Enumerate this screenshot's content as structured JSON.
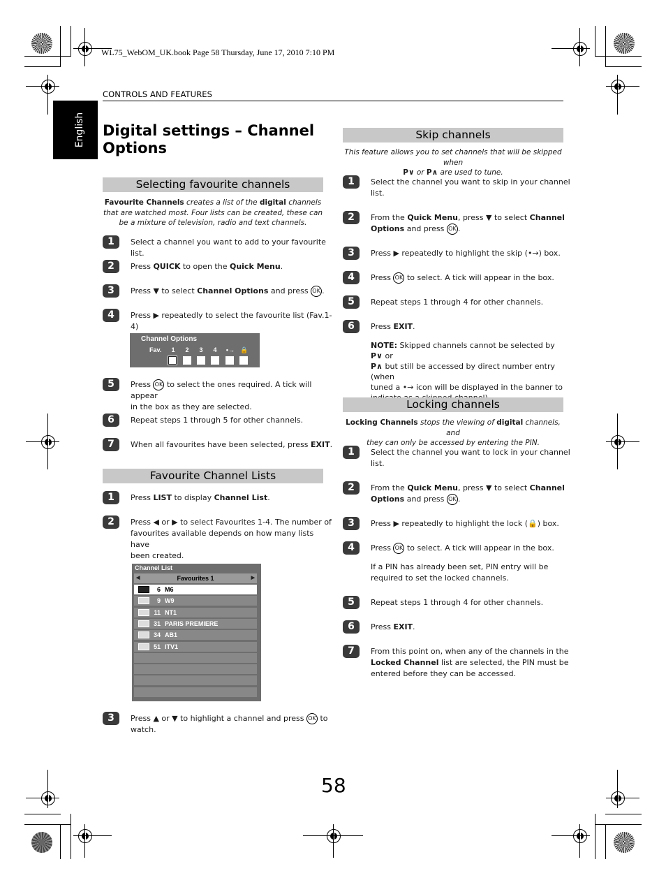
{
  "book_header": "WL75_WebOM_UK.book  Page 58  Thursday, June 17, 2010  7:10 PM",
  "section_label": "CONTROLS AND FEATURES",
  "language_tab": "English",
  "page_title": "Digital settings – Channel Options",
  "page_number": "58",
  "selecting_favourites": {
    "heading": "Selecting favourite channels",
    "intro_bold1": "Favourite Channels",
    "intro_part1": " creates a list of the ",
    "intro_bold2": "digital",
    "intro_part2": " channels that are watched most. Four lists can be created, these can be a mixture of television, radio and text channels.",
    "steps": [
      {
        "num": "1",
        "html": "Select a channel you want to add to your favourite list."
      },
      {
        "num": "2",
        "html": "Press <b>QUICK</b> to open the <b>Quick Menu</b>."
      },
      {
        "num": "3",
        "html": "Press ▼ to select <b>Channel Options</b> and press <span class='ok'>OK</span>."
      },
      {
        "num": "4",
        "html": "Press ▶ repeatedly to select the favourite list (Fav.1-4)"
      },
      {
        "num": "5",
        "html": "Press <span class='ok'>OK</span> to select the ones required. A tick will appear<br>in the box as they are selected."
      },
      {
        "num": "6",
        "html": "Repeat steps 1 through 5 for other channels."
      },
      {
        "num": "7",
        "html": "When all favourites have been selected, press <b>EXIT</b>."
      }
    ]
  },
  "channel_options_panel": {
    "title": "Channel Options",
    "row_label": "Fav.",
    "columns": [
      "1",
      "2",
      "3",
      "4",
      "skip-icon",
      "lock-icon"
    ],
    "selected_column": "1"
  },
  "favourite_lists": {
    "heading": "Favourite Channel Lists",
    "steps": [
      {
        "num": "1",
        "html": "Press <b>LIST</b> to display <b>Channel List</b>."
      },
      {
        "num": "2",
        "html": "Press ◀ or ▶ to select Favourites 1-4. The number of<br>favourites available depends on how many lists have<br>been created."
      },
      {
        "num": "3",
        "html": "Press ▲ or ▼ to highlight a channel and press <span class='ok'>OK</span> to<br>watch."
      }
    ]
  },
  "channel_list_panel": {
    "title": "Channel List",
    "tab_label": "Favourites 1",
    "rows": [
      {
        "num": "6",
        "name": "M6",
        "selected": true
      },
      {
        "num": "9",
        "name": "W9",
        "selected": false
      },
      {
        "num": "11",
        "name": "NT1",
        "selected": false
      },
      {
        "num": "31",
        "name": "PARIS PREMIERE",
        "selected": false
      },
      {
        "num": "34",
        "name": "AB1",
        "selected": false
      },
      {
        "num": "51",
        "name": "ITV1",
        "selected": false
      }
    ],
    "empty_rows": 4
  },
  "skip_channels": {
    "heading": "Skip channels",
    "intro_html": "This feature allows you to set channels that will be skipped when<br><b>P∨</b> or <b>P∧</b> are used to tune.",
    "steps": [
      {
        "num": "1",
        "html": "Select the channel you want to skip in your channel<br>list."
      },
      {
        "num": "2",
        "html": "From the <b>Quick Menu</b>, press ▼ to select <b>Channel<br>Options</b> and press <span class='ok'>OK</span>."
      },
      {
        "num": "3",
        "html": "Press ▶ repeatedly to highlight the skip (•→) box."
      },
      {
        "num": "4",
        "html": "Press <span class='ok'>OK</span> to select. A tick will appear in the box."
      },
      {
        "num": "5",
        "html": "Repeat steps 1 through 4 for other channels."
      },
      {
        "num": "6",
        "html": "Press <b>EXIT</b>."
      }
    ],
    "note_html": "<b>NOTE:</b> Skipped channels cannot be selected by <b>P∨</b> or<br><b>P∧</b> but still be accessed by direct number entry (when<br>tuned a •→ icon will be displayed in the banner to<br>indicate as a skipped channel)."
  },
  "locking_channels": {
    "heading": "Locking channels",
    "intro_html": "<b>Locking Channels</b> stops the viewing of <b>digital</b> channels, and<br>they can only be accessed by entering the PIN.",
    "steps": [
      {
        "num": "1",
        "html": "Select the channel you want to lock in your channel<br>list."
      },
      {
        "num": "2",
        "html": "From the <b>Quick Menu</b>, press ▼ to select <b>Channel<br>Options</b> and press <span class='ok'>OK</span>."
      },
      {
        "num": "3",
        "html": "Press ▶ repeatedly to highlight the lock (🔒) box."
      },
      {
        "num": "4",
        "html": "Press <span class='ok'>OK</span> to select. A tick will appear in the box."
      },
      {
        "num": "5",
        "html": "Repeat steps 1 through 4 for other channels."
      },
      {
        "num": "6",
        "html": "Press <b>EXIT</b>."
      },
      {
        "num": "7",
        "html": "From this point on, when any of the channels in the<br><b>Locked Channel</b> list are selected, the PIN must be<br>entered before they can be accessed."
      }
    ],
    "pin_note": "If a PIN has already been set, PIN entry will be required to set the locked channels."
  }
}
